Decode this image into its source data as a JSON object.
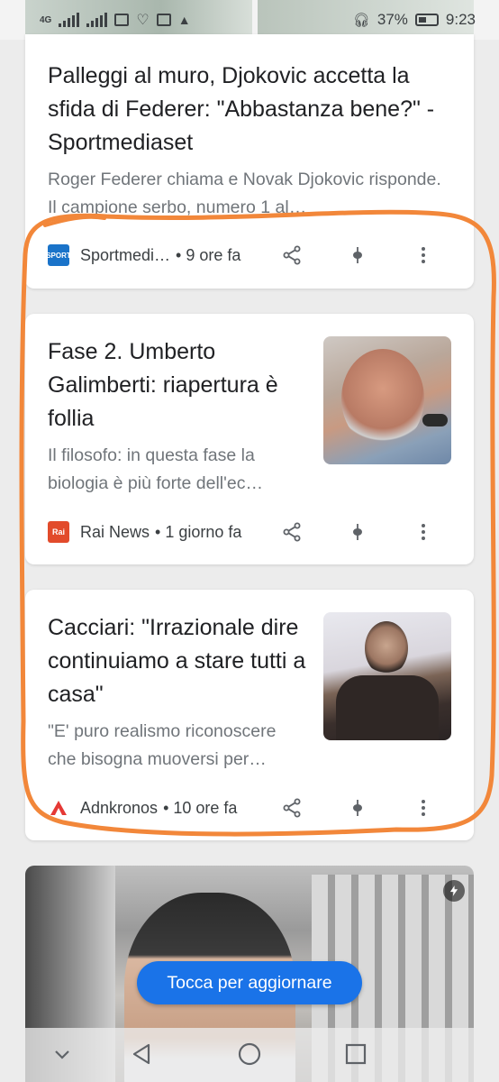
{
  "status_bar": {
    "network_label": "4G",
    "battery_percent": "37%",
    "time": "9:23"
  },
  "articles": [
    {
      "title": "Palleggi al muro, Djokovic accetta la sfida di Federer: \"Abbastanza bene?\" - Sportmediaset",
      "snippet": "Roger Federer chiama e Novak Djokovic risponde. Il campione serbo, numero 1 al…",
      "source": "Sportmedi…",
      "source_logo_text": "SPORT",
      "time": "• 9 ore fa",
      "has_thumbnail": false
    },
    {
      "title": "Fase 2. Umberto Galimberti: riapertura è follia",
      "snippet": "Il filosofo: in questa fase la biologia è più forte dell'ec…",
      "source": "Rai News",
      "source_logo_text": "Rai",
      "time": "• 1 giorno fa",
      "has_thumbnail": true
    },
    {
      "title": "Cacciari: \"Irrazionale dire continuiamo a stare tutti a casa\"",
      "snippet": "\"E' puro realismo riconoscere che bisogna muoversi per…",
      "source": "Adnkronos",
      "source_logo_text": "",
      "time": "• 10 ore fa",
      "has_thumbnail": true
    }
  ],
  "refresh_button": {
    "label": "Tocca per aggiornare"
  },
  "colors": {
    "annotation": "#f2873a",
    "accent": "#1a73e8"
  },
  "icons": [
    "share-icon",
    "pin-icon",
    "more-vert-icon",
    "flash-icon",
    "back-icon",
    "home-icon",
    "recents-icon",
    "chevron-down-icon"
  ]
}
